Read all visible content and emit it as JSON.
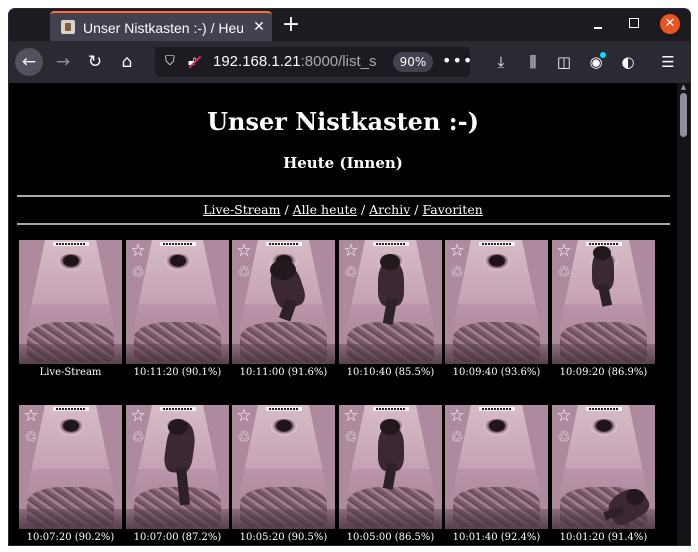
{
  "browser": {
    "tab_title": "Unser Nistkasten :-) / Heute",
    "tab_close": "✕",
    "new_tab": "+",
    "url_host": "192.168.1.21",
    "url_rest": ":8000/list_s",
    "zoom": "90%",
    "url_more": "•••",
    "window_close": "✕"
  },
  "page": {
    "title": "Unser Nistkasten :-)",
    "subtitle": "Heute (Innen)",
    "links": {
      "live": "Live-Stream",
      "today": "Alle heute",
      "archive": "Archiv",
      "favorites": "Favoriten",
      "separator": "/"
    }
  },
  "images": [
    {
      "caption": "Live-Stream",
      "live": true,
      "bird": "none"
    },
    {
      "caption": "10:11:20 (90.1%)",
      "bird": "none"
    },
    {
      "caption": "10:11:00 (91.6%)",
      "bird": "top-wide"
    },
    {
      "caption": "10:10:40 (85.5%)",
      "bird": "center"
    },
    {
      "caption": "10:09:40 (93.6%)",
      "bird": "none"
    },
    {
      "caption": "10:09:20 (86.9%)",
      "bird": "top-right"
    },
    {
      "caption": "10:07:20 (90.2%)",
      "bird": "none"
    },
    {
      "caption": "10:07:00 (87.2%)",
      "bird": "tall-left"
    },
    {
      "caption": "10:05:20 (90.5%)",
      "bird": "none"
    },
    {
      "caption": "10:05:00 (86.5%)",
      "bird": "center"
    },
    {
      "caption": "10:01:40 (92.4%)",
      "bird": "none"
    },
    {
      "caption": "10:01:20 (91.4%)",
      "bird": "bottom-right"
    }
  ],
  "icons": {
    "favorite": "☆",
    "recycle": "♲"
  },
  "colors": {
    "page_background": "#000000",
    "text": "#ffffff",
    "tab_accent": "#ff6a3d",
    "window_close": "#e95420"
  }
}
